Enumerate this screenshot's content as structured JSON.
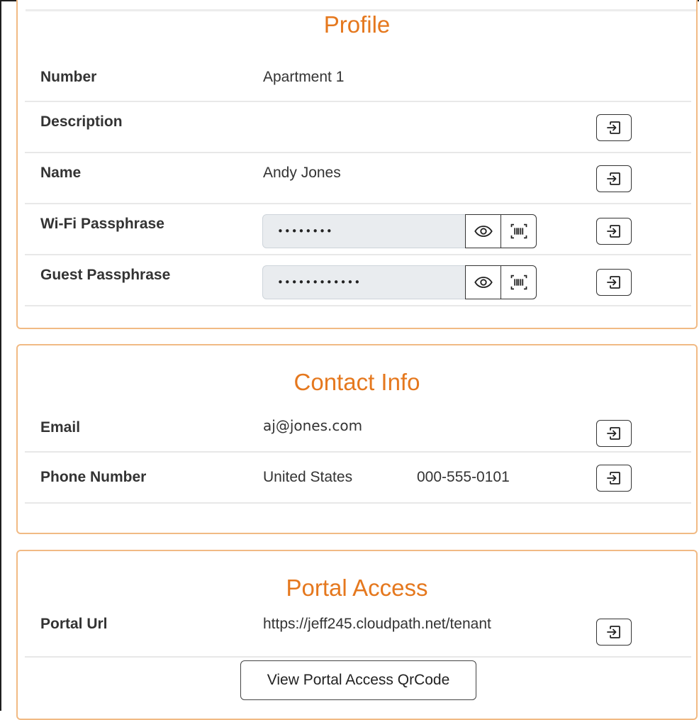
{
  "profile": {
    "title": "Profile",
    "number": {
      "label": "Number",
      "value": "Apartment 1"
    },
    "description": {
      "label": "Description",
      "value": ""
    },
    "name": {
      "label": "Name",
      "value": "Andy Jones"
    },
    "wifi_passphrase": {
      "label": "Wi-Fi Passphrase",
      "masked_value": "••••••••"
    },
    "guest_passphrase": {
      "label": "Guest Passphrase",
      "masked_value": "••••••••••••"
    }
  },
  "contact": {
    "title": "Contact Info",
    "email": {
      "label": "Email",
      "value": "aj@jones.com"
    },
    "phone": {
      "label": "Phone Number",
      "country": "United States",
      "number": "000-555-0101"
    }
  },
  "portal": {
    "title": "Portal Access",
    "url": {
      "label": "Portal Url",
      "value": "https://jeff245.cloudpath.net/tenant"
    },
    "qr_button_label": "View Portal Access QrCode"
  },
  "icons": {
    "edit": "sign-in-icon",
    "show_password": "eye-icon",
    "qr": "barcode-scan-icon"
  },
  "colors": {
    "accent": "#e5781e",
    "card_border": "#f1ba84",
    "input_bg": "#e9ecef"
  }
}
